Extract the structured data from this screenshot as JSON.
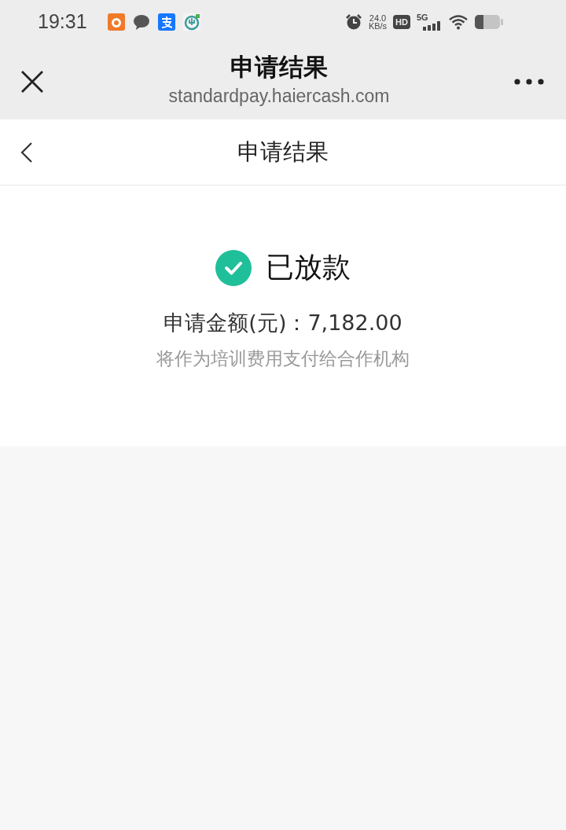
{
  "status_bar": {
    "time": "19:31",
    "speed_value": "24.0",
    "speed_unit": "KB/s",
    "hd": "HD",
    "network": "5G"
  },
  "browser_header": {
    "title": "申请结果",
    "url": "standardpay.haiercash.com"
  },
  "nav_bar": {
    "title": "申请结果"
  },
  "result": {
    "status": "已放款",
    "amount_line": "申请金额(元)：7,182.00",
    "note": "将作为培训费用支付给合作机构"
  }
}
